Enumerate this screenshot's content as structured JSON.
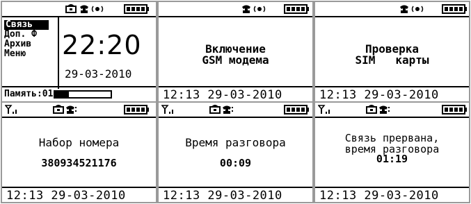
{
  "main": {
    "menu": [
      "Связь",
      "Доп. Ф",
      "Архив",
      "Меню"
    ],
    "time": "22:20",
    "date": "29-03-2010",
    "memory_label": "Память:01",
    "memory_fraction": 0.25
  },
  "screen2": {
    "line1": "Включение",
    "line2": "GSM модема"
  },
  "screen3": {
    "line1": "Проверка",
    "line2": "SIM   карты"
  },
  "screen4": {
    "line1": "Набор номера",
    "line2": "380934521176"
  },
  "screen5": {
    "line1": "Время разговора",
    "line2": "00:09"
  },
  "screen6": {
    "line1": "Связь прервана,",
    "line2": "время разговора",
    "line3": "01:19"
  },
  "footer": "12:13 29-03-2010",
  "icons": [
    "signal-icon",
    "antenna-icon",
    "phone-icon",
    "speaker-icon",
    "battery-icon"
  ]
}
